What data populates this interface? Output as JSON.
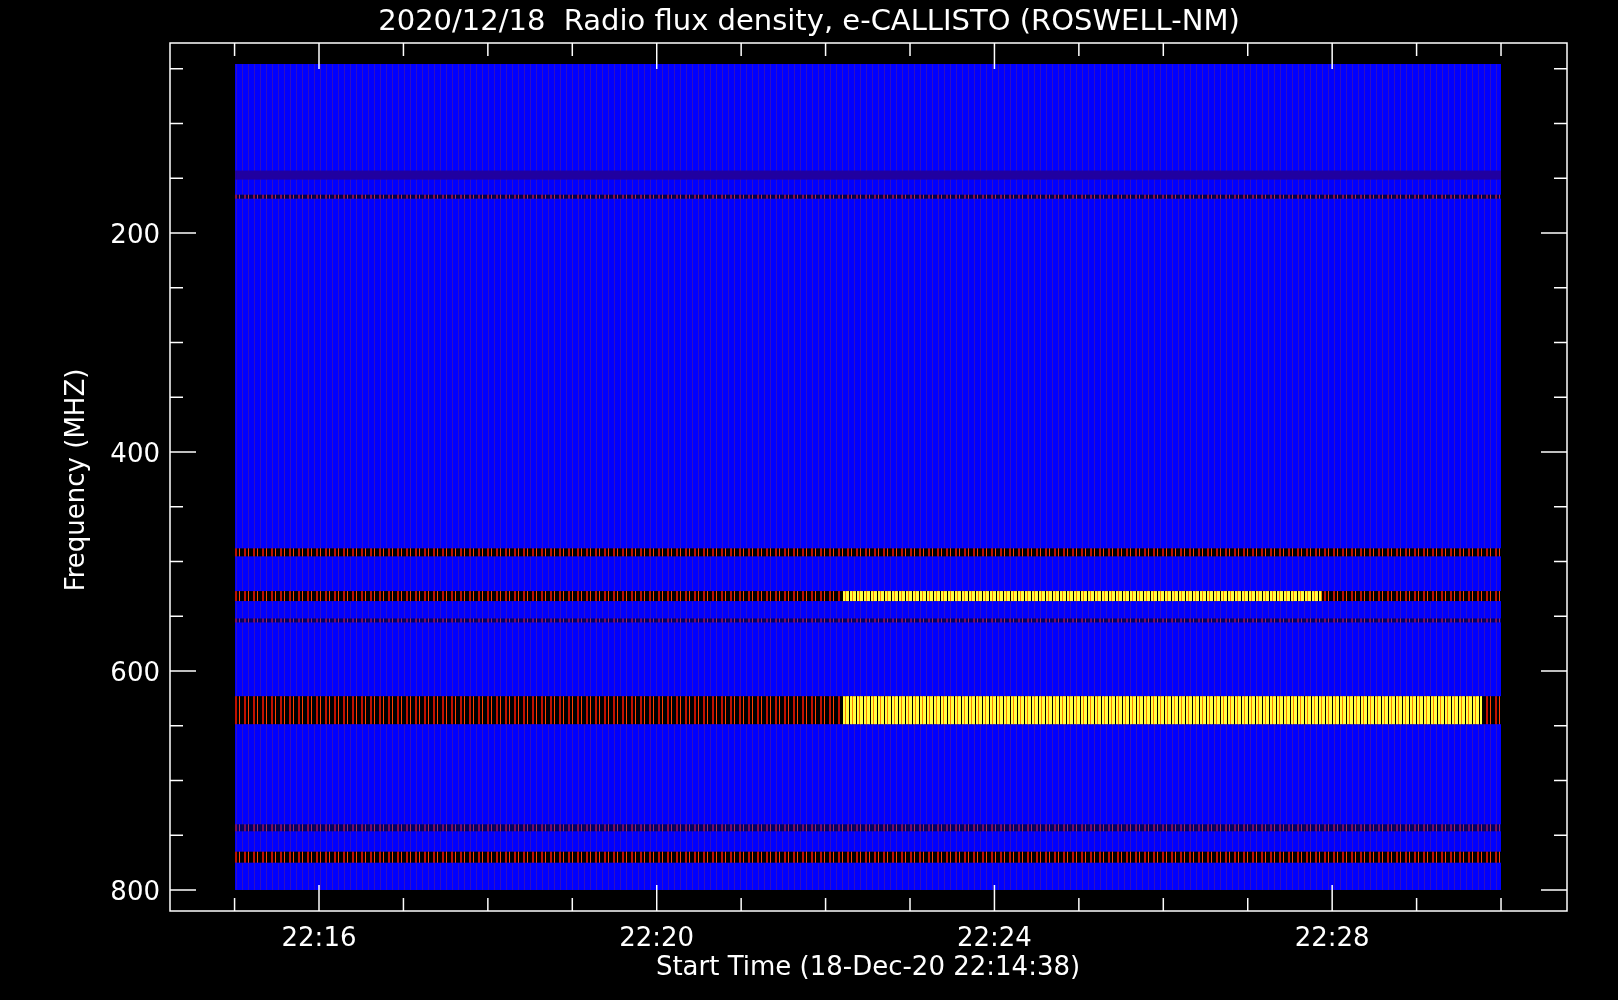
{
  "title": "2020/12/18  Radio flux density, e-CALLISTO (ROSWELL-NM)",
  "y_axis": {
    "label": "Frequency (MHZ)",
    "ticks": [
      "200",
      "400",
      "600",
      "800"
    ]
  },
  "x_axis": {
    "label": "Start Time (18-Dec-20 22:14:38)",
    "ticks": [
      "22:16",
      "22:20",
      "22:24",
      "22:28"
    ]
  }
}
